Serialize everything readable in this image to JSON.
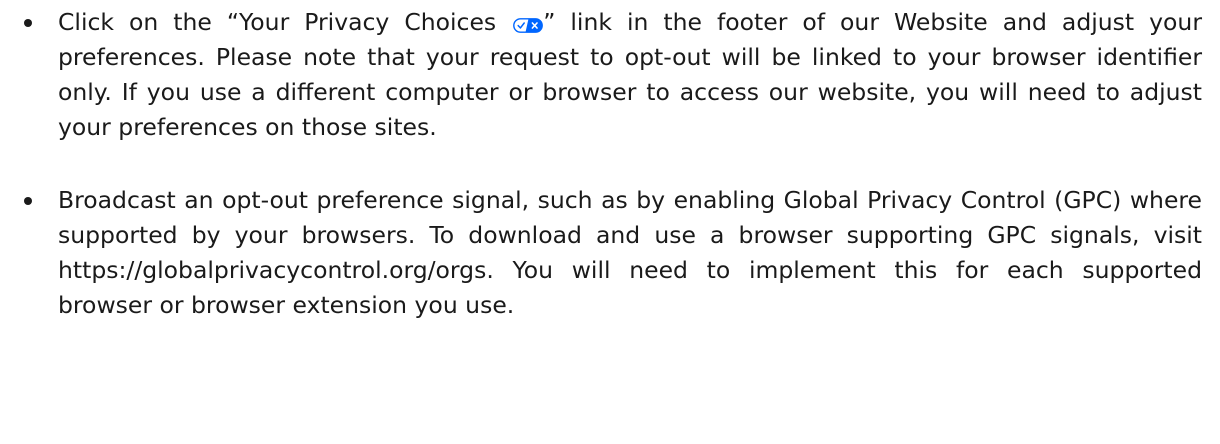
{
  "bullets": [
    {
      "text_before_icon": "Click on the “Your Privacy Choices ",
      "icon": "privacy-choices-toggle-icon",
      "text_after_icon": "” link in the footer of our Website and adjust your preferences. Please note that your request to opt-out will be linked to your browser identifier only. If you use a different computer or browser to access our website, you will need to adjust your preferences on those sites."
    },
    {
      "text": "Broadcast an opt-out preference signal, such as by enabling Global Privacy Control (GPC) where supported by your browsers. To download and use a browser supporting GPC signals, visit https://globalprivacycontrol.org/orgs. You will need to implement this for each supported browser or browser extension you use."
    }
  ],
  "colors": {
    "text": "#1a1a1a",
    "icon_blue": "#0066ff",
    "background": "#ffffff"
  }
}
